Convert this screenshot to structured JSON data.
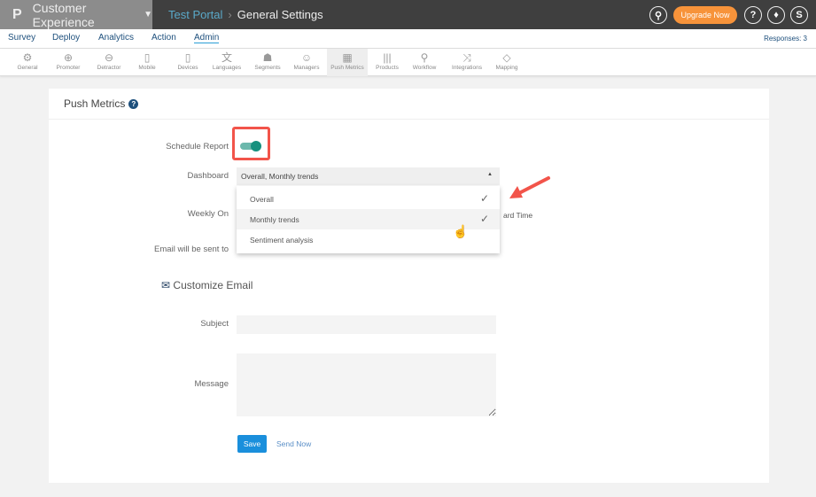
{
  "topbar": {
    "logo": "P",
    "app": "Customer Experience",
    "portal": "Test Portal",
    "page": "General Settings",
    "upgrade": "Upgrade Now",
    "avatar": "S",
    "icons": [
      "search-icon",
      "help-icon",
      "bell-icon"
    ]
  },
  "nav": {
    "items": [
      "Survey",
      "Deploy",
      "Analytics",
      "Action",
      "Admin"
    ],
    "active": "Admin",
    "responses": "Responses: 3"
  },
  "tools": [
    {
      "label": "General",
      "icon": "⚙"
    },
    {
      "label": "Promoter",
      "icon": "⊕"
    },
    {
      "label": "Detractor",
      "icon": "⊖"
    },
    {
      "label": "Mobile",
      "icon": "▯"
    },
    {
      "label": "Devices",
      "icon": "▯"
    },
    {
      "label": "Languages",
      "icon": "文"
    },
    {
      "label": "Segments",
      "icon": "☗"
    },
    {
      "label": "Managers",
      "icon": "☺"
    },
    {
      "label": "Push Metrics",
      "icon": "▦"
    },
    {
      "label": "Products",
      "icon": "|||"
    },
    {
      "label": "Workflow",
      "icon": "⚲"
    },
    {
      "label": "Integrations",
      "icon": "⤨"
    },
    {
      "label": "Mapping",
      "icon": "◇"
    }
  ],
  "card": {
    "title": "Push Metrics",
    "schedule_label": "Schedule Report",
    "schedule_on": true,
    "dashboard_label": "Dashboard",
    "dashboard_value": "Overall, Monthly trends",
    "options": [
      {
        "label": "Overall",
        "checked": true
      },
      {
        "label": "Monthly trends",
        "checked": true
      },
      {
        "label": "Sentiment analysis",
        "checked": false
      }
    ],
    "weekly_label": "Weekly On",
    "timezone_partial": "ard Time",
    "email_label": "Email will be sent to",
    "customize_title": "Customize Email",
    "subject_label": "Subject",
    "subject_value": "",
    "message_label": "Message",
    "message_value": "",
    "save": "Save",
    "send_now": "Send Now"
  },
  "colors": {
    "accent": "#2a9fd6",
    "toggle": "#16907e",
    "upgrade": "#f7933a",
    "highlight": "#f2544a"
  }
}
